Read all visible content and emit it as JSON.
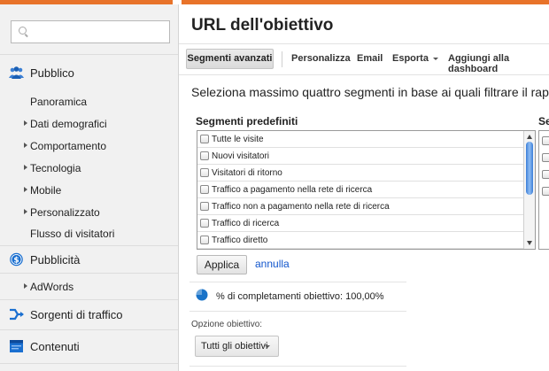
{
  "sidebar": {
    "search_placeholder": "",
    "sections": [
      {
        "label": "Pubblico",
        "icon": "audience-icon"
      },
      {
        "label": "Pubblicità",
        "icon": "dollar-icon"
      },
      {
        "label": "Sorgenti di traffico",
        "icon": "traffic-sources-icon"
      },
      {
        "label": "Contenuti",
        "icon": "content-icon"
      }
    ],
    "audience_items": [
      {
        "label": "Panoramica",
        "expandable": false
      },
      {
        "label": "Dati demografici",
        "expandable": true
      },
      {
        "label": "Comportamento",
        "expandable": true
      },
      {
        "label": "Tecnologia",
        "expandable": true
      },
      {
        "label": "Mobile",
        "expandable": true
      },
      {
        "label": "Personalizzato",
        "expandable": true
      },
      {
        "label": "Flusso di visitatori",
        "expandable": false
      }
    ],
    "advertising_items": [
      {
        "label": "AdWords",
        "expandable": true
      }
    ]
  },
  "main": {
    "title": "URL dell'obiettivo",
    "toolbar": {
      "advanced_segments": "Segmenti avanzati",
      "customize": "Personalizza",
      "email": "Email",
      "export": "Esporta",
      "add_dashboard": "Aggiungi alla dashboard"
    },
    "instruction": "Seleziona massimo quattro segmenti in base ai quali filtrare il rappor",
    "predefined_header": "Segmenti predefiniti",
    "custom_header_partial": "Se",
    "segments": [
      "Tutte le visite",
      "Nuovi visitatori",
      "Visitatori di ritorno",
      "Traffico a pagamento nella rete di ricerca",
      "Traffico non a pagamento nella rete di ricerca",
      "Traffico di ricerca",
      "Traffico diretto"
    ],
    "apply_label": "Applica",
    "cancel_label": "annulla",
    "goal_completion_text": "% di completamenti obiettivo: 100,00%",
    "goal_option_label": "Opzione obiettivo:",
    "goal_select_value": "Tutti gli obiettivi"
  },
  "colors": {
    "top_bar": "#e8732a",
    "accent_blue": "#1a73c8",
    "link": "#1155cc"
  }
}
